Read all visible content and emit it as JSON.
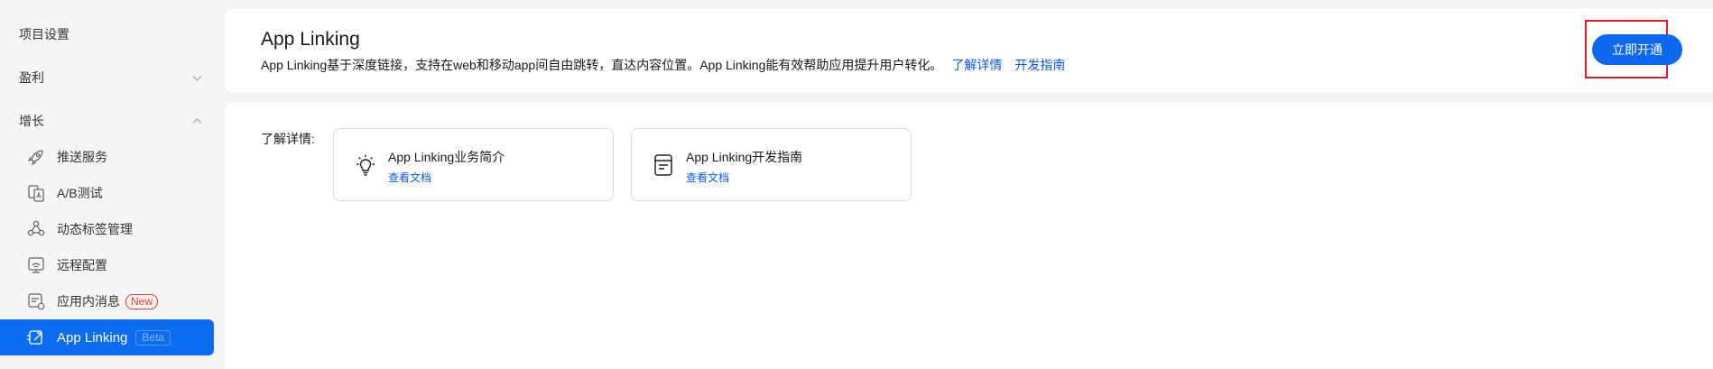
{
  "sidebar": {
    "project_settings": "项目设置",
    "monetize": "盈利",
    "growth": "增长",
    "items": [
      {
        "label": "推送服务",
        "icon": "rocket-icon"
      },
      {
        "label": "A/B测试",
        "icon": "ab-test-icon"
      },
      {
        "label": "动态标签管理",
        "icon": "tag-network-icon"
      },
      {
        "label": "远程配置",
        "icon": "remote-config-icon"
      },
      {
        "label": "应用内消息",
        "icon": "in-app-message-icon",
        "badge": "New"
      },
      {
        "label": "App Linking",
        "icon": "app-linking-icon",
        "badge": "Beta",
        "active": true
      }
    ]
  },
  "header": {
    "title": "App Linking",
    "description": "App Linking基于深度链接，支持在web和移动app间自由跳转，直达内容位置。App Linking能有效帮助应用提升用户转化。",
    "link_learn_more": "了解详情",
    "link_dev_guide": "开发指南",
    "activate_button": "立即开通"
  },
  "main": {
    "learn_label": "了解详情:",
    "cards": [
      {
        "title": "App Linking业务简介",
        "action": "查看文档",
        "icon": "lightbulb-icon"
      },
      {
        "title": "App Linking开发指南",
        "action": "查看文档",
        "icon": "document-icon"
      }
    ]
  },
  "colors": {
    "primary": "#0A59F7",
    "active_nav": "#0B68F0",
    "highlight_frame": "#E0181F",
    "badge_new": "#E84026"
  }
}
